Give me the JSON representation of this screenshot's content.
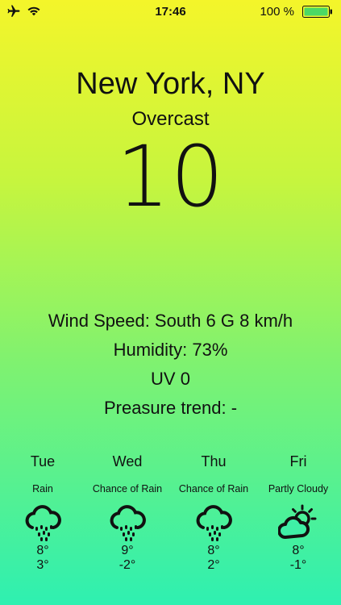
{
  "status_bar": {
    "time": "17:46",
    "battery_percent": "100 %",
    "icons": [
      "airplane-icon",
      "wifi-icon",
      "battery-icon"
    ]
  },
  "location": {
    "city": "New York, NY",
    "condition": "Overcast",
    "temperature": "10"
  },
  "details": {
    "wind": "Wind Speed: South 6 G 8 km/h",
    "humidity": "Humidity: 73%",
    "uv": "UV 0",
    "pressure": "Preasure trend: -"
  },
  "forecast": [
    {
      "day": "Tue",
      "condition": "Rain",
      "icon": "rain-cloud-icon",
      "high": "8°",
      "low": "3°"
    },
    {
      "day": "Wed",
      "condition": "Chance of Rain",
      "icon": "rain-cloud-icon",
      "high": "9°",
      "low": "-2°"
    },
    {
      "day": "Thu",
      "condition": "Chance of Rain",
      "icon": "rain-cloud-icon",
      "high": "8°",
      "low": "2°"
    },
    {
      "day": "Fri",
      "condition": "Partly Cloudy",
      "icon": "partly-cloudy-icon",
      "high": "8°",
      "low": "-1°"
    }
  ],
  "colors": {
    "gradient_top": "#f4f52a",
    "gradient_bottom": "#2ef0b1",
    "text": "#111111",
    "battery_fill": "#4cd964"
  }
}
